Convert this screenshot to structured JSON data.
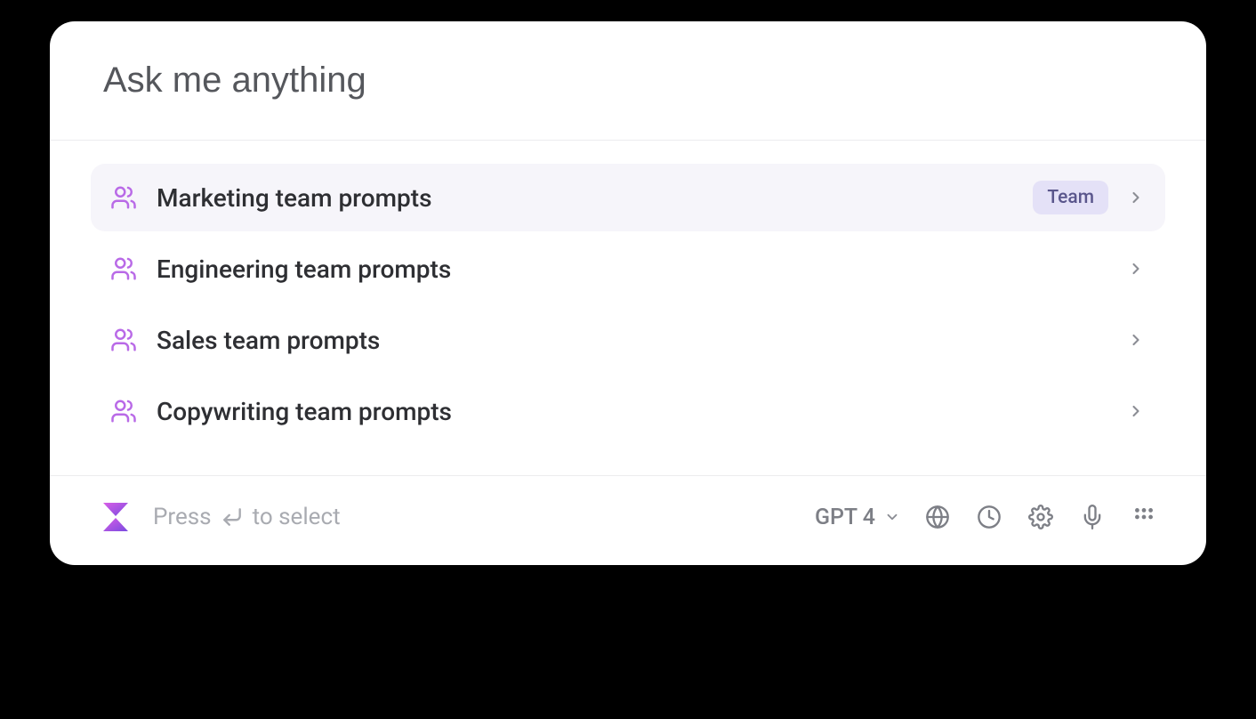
{
  "search": {
    "placeholder": "Ask me anything",
    "value": ""
  },
  "prompt_groups": [
    {
      "label": "Marketing team prompts",
      "badge": "Team",
      "selected": true
    },
    {
      "label": "Engineering team prompts",
      "badge": null,
      "selected": false
    },
    {
      "label": "Sales team prompts",
      "badge": null,
      "selected": false
    },
    {
      "label": "Copywriting team prompts",
      "badge": null,
      "selected": false
    }
  ],
  "footer": {
    "hint_prefix": "Press",
    "hint_suffix": "to select",
    "model_label": "GPT 4"
  }
}
